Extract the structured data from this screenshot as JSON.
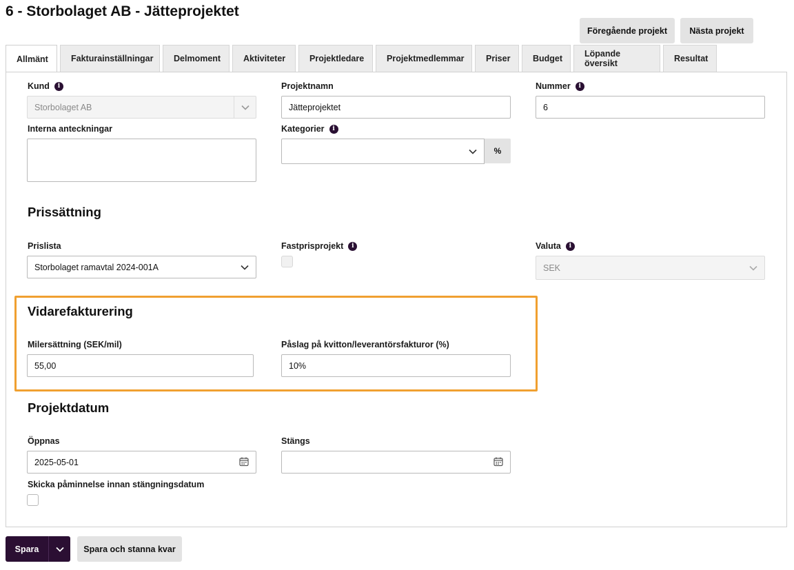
{
  "page": {
    "title": "6 - Storbolaget AB - Jätteprojektet"
  },
  "nav_buttons": {
    "previous": "Föregående projekt",
    "next": "Nästa projekt"
  },
  "tabs": [
    {
      "label": "Allmänt",
      "active": true
    },
    {
      "label": "Fakturainställningar"
    },
    {
      "label": "Delmoment"
    },
    {
      "label": "Aktiviteter"
    },
    {
      "label": "Projektledare"
    },
    {
      "label": "Projektmedlemmar"
    },
    {
      "label": "Priser"
    },
    {
      "label": "Budget"
    },
    {
      "label": "Löpande översikt"
    },
    {
      "label": "Resultat"
    }
  ],
  "general": {
    "customer": {
      "label": "Kund",
      "value": "Storbolaget AB"
    },
    "project_name": {
      "label": "Projektnamn",
      "value": "Jätteprojektet"
    },
    "number": {
      "label": "Nummer",
      "value": "6"
    },
    "internal_notes": {
      "label": "Interna anteckningar",
      "value": ""
    },
    "categories": {
      "label": "Kategorier",
      "value": "",
      "addon": "%"
    }
  },
  "pricing": {
    "title": "Prissättning",
    "price_list": {
      "label": "Prislista",
      "value": "Storbolaget ramavtal 2024-001A"
    },
    "fixed_price": {
      "label": "Fastprisprojekt",
      "checked": false
    },
    "currency": {
      "label": "Valuta",
      "value": "SEK"
    }
  },
  "rebilling": {
    "title": "Vidarefakturering",
    "mileage": {
      "label": "Milersättning (SEK/mil)",
      "value": "55,00"
    },
    "markup": {
      "label": "Påslag på kvitton/leverantörsfakturor (%)",
      "value": "10%"
    }
  },
  "dates": {
    "title": "Projektdatum",
    "opens": {
      "label": "Öppnas",
      "value": "2025-05-01"
    },
    "closes": {
      "label": "Stängs",
      "value": ""
    },
    "reminder": {
      "label": "Skicka påminnelse innan stängningsdatum",
      "checked": false
    }
  },
  "footer": {
    "save": "Spara",
    "save_stay": "Spara och stanna kvar"
  },
  "colors": {
    "primary": "#2b0f33",
    "highlight": "#f0a030",
    "info_icon": "#2a1033"
  }
}
